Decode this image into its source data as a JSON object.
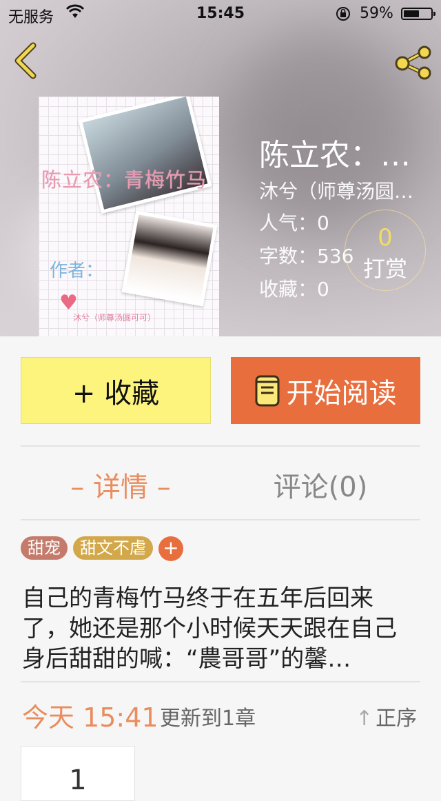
{
  "status_bar": {
    "carrier": "无服务",
    "time": "15:45",
    "battery": "59%",
    "battery_level": 0.59
  },
  "book": {
    "title": "陈立农：…",
    "author": "沐兮（师尊汤圆…",
    "popularity": "人气：0",
    "word_count": "字数：536",
    "favorites": "收藏：0",
    "cover_title": "陈立农：青梅竹马",
    "cover_author": "作者：",
    "cover_sub": "沐兮（师尊汤圆可可）"
  },
  "tip": {
    "count": "0",
    "label": "打赏"
  },
  "actions": {
    "favorite": "+ 收藏",
    "read": "开始阅读"
  },
  "tabs": {
    "detail": "– 详情 –",
    "comments": "评论(0)"
  },
  "tags": [
    {
      "label": "甜宠",
      "color": "#c47b6b"
    },
    {
      "label": "甜文不虐",
      "color": "#d2a84a"
    }
  ],
  "tag_add": "+",
  "description": "自己的青梅竹马终于在五年后回来了，她还是那个小时候天天跟在自己身后甜甜的喊：“農哥哥”的馨…",
  "update": {
    "time": "今天 15:41",
    "text": "更新到1章",
    "sort": "正序"
  },
  "chapter": {
    "number": "1"
  },
  "colors": {
    "accent": "#e86e3d",
    "favorite_bg": "#fdf47e",
    "highlight": "#e98d5f"
  }
}
